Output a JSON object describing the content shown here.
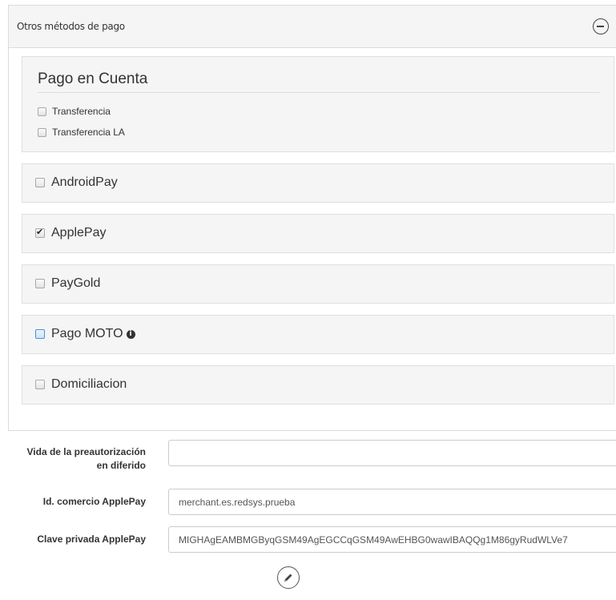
{
  "panel": {
    "title": "Otros métodos de pago",
    "collapse_icon": "minus-circle-icon"
  },
  "pago_cuenta": {
    "title": "Pago en Cuenta",
    "options": [
      {
        "label": "Transferencia",
        "checked": false
      },
      {
        "label": "Transferencia LA",
        "checked": false
      }
    ]
  },
  "methods": [
    {
      "label": "AndroidPay",
      "checked": false
    },
    {
      "label": "ApplePay",
      "checked": true
    },
    {
      "label": "PayGold",
      "checked": false
    },
    {
      "label": "Pago MOTO",
      "checked": false,
      "info_icon": "info-circle-icon"
    },
    {
      "label": "Domiciliacion",
      "checked": false
    }
  ],
  "form": {
    "preauth_label_line1": "Vida de la preautorización",
    "preauth_label_line2": "en diferido",
    "preauth_value": "",
    "applepay_id_label": "Id. comercio ApplePay",
    "applepay_id_value": "merchant.es.redsys.prueba",
    "applepay_key_label": "Clave privada ApplePay",
    "applepay_key_value": "MIGHAgEAMBMGByqGSM49AgEGCCqGSM49AwEHBG0wawIBAQQg1M86gyRudWLVe7",
    "edit_icon": "pencil-icon"
  }
}
